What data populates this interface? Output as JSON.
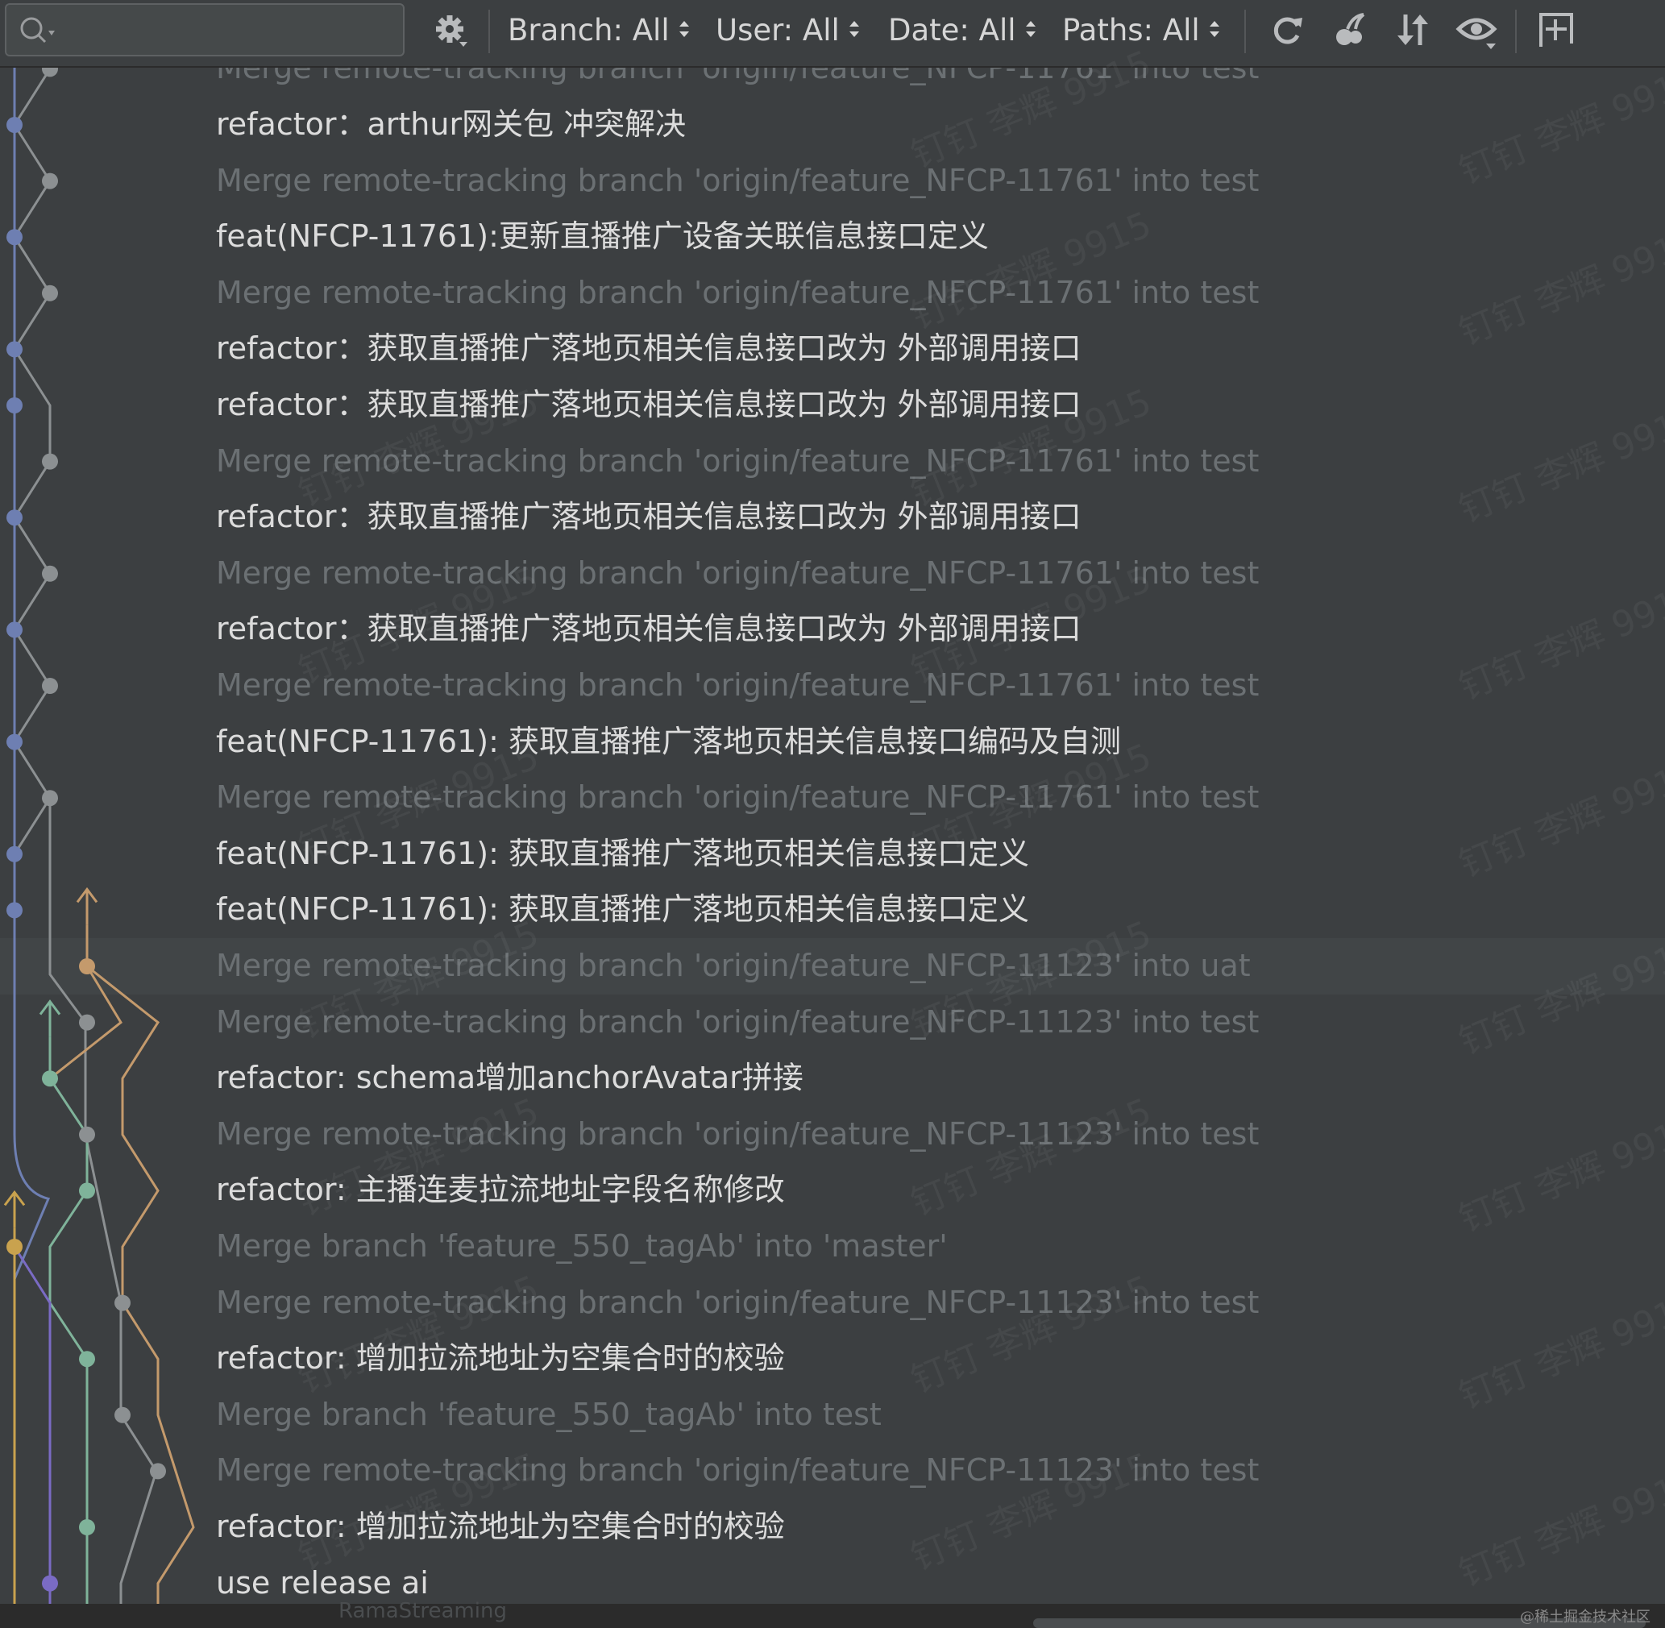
{
  "toolbar": {
    "search": {
      "placeholder": "",
      "value": ""
    },
    "filters": [
      {
        "label": "Branch: All"
      },
      {
        "label": "User: All"
      },
      {
        "label": "Date: All"
      },
      {
        "label": "Paths: All"
      }
    ],
    "icons": [
      "settings-icon",
      "refresh-icon",
      "cherry-pick-icon",
      "sort-icon",
      "eye-icon",
      "new-tab-icon"
    ]
  },
  "log": {
    "top_partial": "Merge remote-tracking branch 'origin/feature_NFCP-11761' into test",
    "commits": [
      {
        "message": "refactor：arthur网关包 冲突解决",
        "merge": false
      },
      {
        "message": "Merge remote-tracking branch 'origin/feature_NFCP-11761' into test",
        "merge": true
      },
      {
        "message": "feat(NFCP-11761):更新直播推广设备关联信息接口定义",
        "merge": false
      },
      {
        "message": "Merge remote-tracking branch 'origin/feature_NFCP-11761' into test",
        "merge": true
      },
      {
        "message": "refactor：获取直播推广落地页相关信息接口改为 外部调用接口",
        "merge": false
      },
      {
        "message": "refactor：获取直播推广落地页相关信息接口改为 外部调用接口",
        "merge": false
      },
      {
        "message": "Merge remote-tracking branch 'origin/feature_NFCP-11761' into test",
        "merge": true
      },
      {
        "message": "refactor：获取直播推广落地页相关信息接口改为 外部调用接口",
        "merge": false
      },
      {
        "message": "Merge remote-tracking branch 'origin/feature_NFCP-11761' into test",
        "merge": true
      },
      {
        "message": "refactor：获取直播推广落地页相关信息接口改为 外部调用接口",
        "merge": false
      },
      {
        "message": "Merge remote-tracking branch 'origin/feature_NFCP-11761' into test",
        "merge": true
      },
      {
        "message": "feat(NFCP-11761): 获取直播推广落地页相关信息接口编码及自测",
        "merge": false
      },
      {
        "message": "Merge remote-tracking branch 'origin/feature_NFCP-11761' into test",
        "merge": true
      },
      {
        "message": "feat(NFCP-11761): 获取直播推广落地页相关信息接口定义",
        "merge": false
      },
      {
        "message": "feat(NFCP-11761): 获取直播推广落地页相关信息接口定义",
        "merge": false
      },
      {
        "message": "Merge remote-tracking branch 'origin/feature_NFCP-11123' into uat",
        "merge": true,
        "selected": true
      },
      {
        "message": "Merge remote-tracking branch 'origin/feature_NFCP-11123' into test",
        "merge": true
      },
      {
        "message": "refactor: schema增加anchorAvatar拼接",
        "merge": false
      },
      {
        "message": "Merge remote-tracking branch 'origin/feature_NFCP-11123' into test",
        "merge": true
      },
      {
        "message": "refactor: 主播连麦拉流地址字段名称修改",
        "merge": false
      },
      {
        "message": "Merge branch 'feature_550_tagAb' into 'master'",
        "merge": true
      },
      {
        "message": "Merge remote-tracking branch 'origin/feature_NFCP-11123' into test",
        "merge": true
      },
      {
        "message": "refactor: 增加拉流地址为空集合时的校验",
        "merge": false
      },
      {
        "message": "Merge branch 'feature_550_tagAb' into test",
        "merge": true
      },
      {
        "message": "Merge remote-tracking branch 'origin/feature_NFCP-11123' into test",
        "merge": true
      },
      {
        "message": "refactor: 增加拉流地址为空集合时的校验",
        "merge": false
      },
      {
        "message": "use release ai",
        "merge": false
      }
    ]
  },
  "watermark": {
    "text": "钉钉 李辉 9915"
  },
  "statusbar": {
    "branch_text": "RamaStreaming",
    "credit": "@稀土掘金技术社区"
  },
  "colors": {
    "bg": "#3c3f41",
    "commit_text": "#dcdcdc",
    "merge_text": "#6b7073",
    "lane_blue": "#6e7fb2",
    "lane_gray": "#8c9092",
    "lane_orange": "#c49a6c",
    "lane_green": "#7fb39a",
    "lane_purple": "#7a6bc4",
    "lane_yellow": "#c9a24e"
  }
}
